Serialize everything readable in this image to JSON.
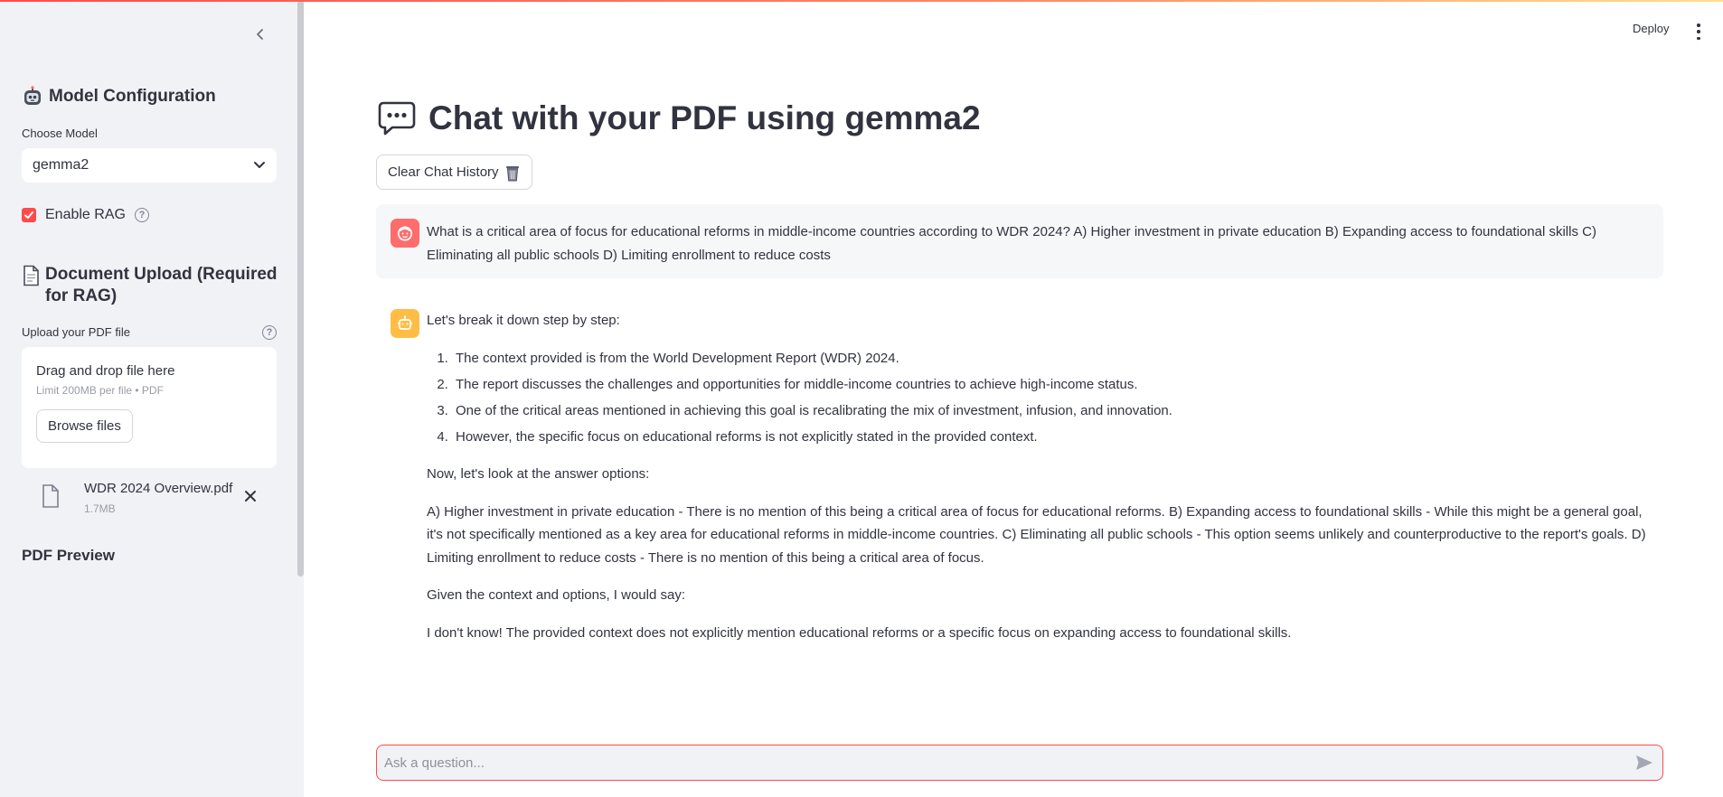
{
  "header": {
    "deploy_label": "Deploy"
  },
  "sidebar": {
    "model_heading": "Model Configuration",
    "model_heading_icon": "robot-face-icon",
    "choose_model_label": "Choose Model",
    "selected_model": "gemma2",
    "enable_rag_label": "Enable RAG",
    "enable_rag_checked": true,
    "upload_heading": "Document Upload (Required for RAG)",
    "upload_heading_icon": "page-icon",
    "upload_label": "Upload your PDF file",
    "dropzone_title": "Drag and drop file here",
    "dropzone_limit": "Limit 200MB per file • PDF",
    "browse_label": "Browse files",
    "uploaded_file": {
      "name": "WDR 2024 Overview.pdf",
      "size": "1.7MB"
    },
    "pdf_preview_heading": "PDF Preview"
  },
  "main": {
    "title": "Chat with your PDF using gemma2",
    "title_icon": "speech-bubble-icon",
    "clear_button_label": "Clear Chat History",
    "clear_button_icon": "wastebasket-icon",
    "messages": [
      {
        "role": "user",
        "text": "What is a critical area of focus for educational reforms in middle-income countries according to WDR 2024? A) Higher investment in private education B) Expanding access to foundational skills C) Eliminating all public schools D) Limiting enrollment to reduce costs"
      },
      {
        "role": "assistant",
        "intro": "Let's break it down step by step:",
        "steps": [
          "The context provided is from the World Development Report (WDR) 2024.",
          "The report discusses the challenges and opportunities for middle-income countries to achieve high-income status.",
          "One of the critical areas mentioned in achieving this goal is recalibrating the mix of investment, infusion, and innovation.",
          "However, the specific focus on educational reforms is not explicitly stated in the provided context."
        ],
        "paragraphs": [
          "Now, let's look at the answer options:",
          "A) Higher investment in private education - There is no mention of this being a critical area of focus for educational reforms. B) Expanding access to foundational skills - While this might be a general goal, it's not specifically mentioned as a key area for educational reforms in middle-income countries. C) Eliminating all public schools - This option seems unlikely and counterproductive to the report's goals. D) Limiting enrollment to reduce costs - There is no mention of this being a critical area of focus.",
          "Given the context and options, I would say:",
          "I don't know! The provided context does not explicitly mention educational reforms or a specific focus on expanding access to foundational skills."
        ]
      }
    ]
  },
  "chat_input": {
    "placeholder": "Ask a question...",
    "value": ""
  },
  "colors": {
    "accent": "#ff4b4b",
    "sidebar_bg": "#f0f2f6",
    "user_avatar": "#ff6c6c",
    "assistant_avatar": "#ffbd45",
    "text": "#31333f"
  }
}
